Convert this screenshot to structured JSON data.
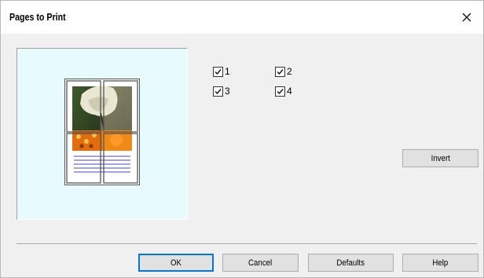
{
  "dialog": {
    "title": "Pages to Print"
  },
  "pages": [
    {
      "label": "1",
      "checked": true
    },
    {
      "label": "2",
      "checked": true
    },
    {
      "label": "3",
      "checked": true
    },
    {
      "label": "4",
      "checked": true
    }
  ],
  "buttons": {
    "invert": "Invert",
    "ok": "OK",
    "cancel": "Cancel",
    "defaults": "Defaults",
    "help": "Help"
  },
  "icons": {
    "close": "close-icon",
    "check": "checkmark-icon"
  },
  "colors": {
    "preview_bg": "#e7fbfc",
    "ok_border": "#0078d7",
    "button_bg": "#e1e1e1"
  }
}
